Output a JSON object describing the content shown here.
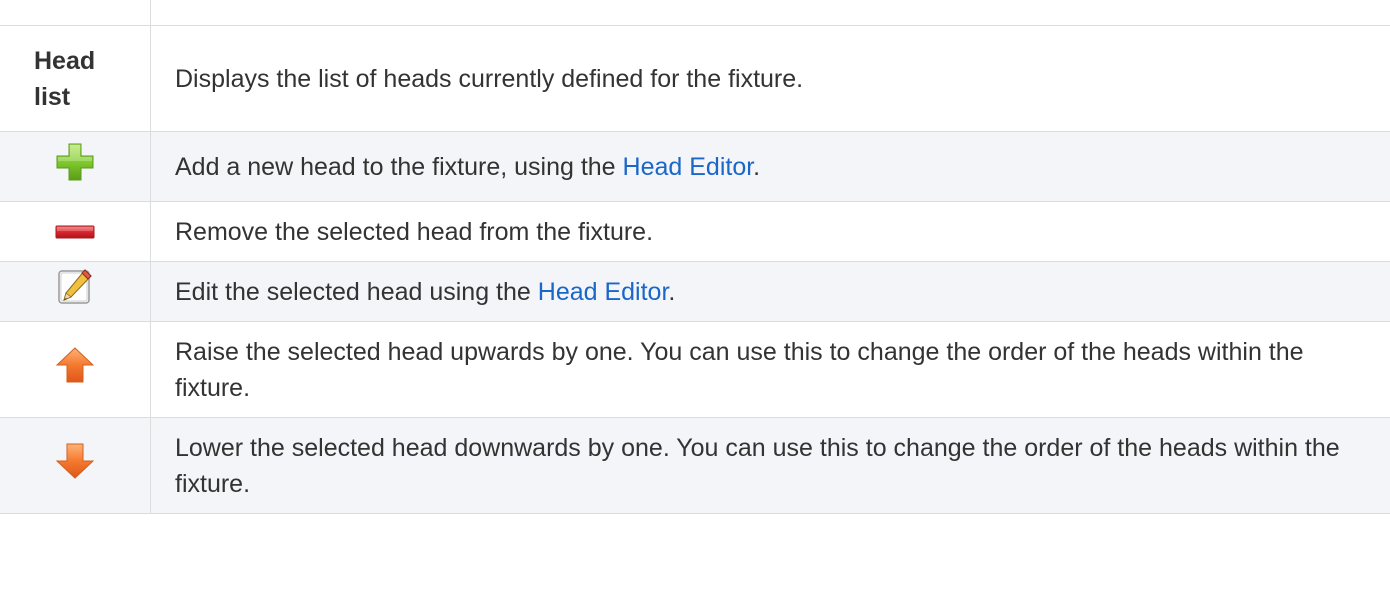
{
  "rows": [
    {
      "term": "Head list",
      "term_line1": "Head",
      "term_line2": "list",
      "description": "Displays the list of heads currently defined for the fixture."
    },
    {
      "icon": "add-plus-icon",
      "text_before": "Add a new head to the fixture, using the ",
      "link": "Head Editor",
      "text_after": "."
    },
    {
      "icon": "remove-minus-icon",
      "description": "Remove the selected head from the fixture."
    },
    {
      "icon": "edit-pencil-icon",
      "text_before": "Edit the selected head using the ",
      "link": "Head Editor",
      "text_after": "."
    },
    {
      "icon": "raise-up-arrow-icon",
      "description": "Raise the selected head upwards by one. You can use this to change the order of the heads within the fixture."
    },
    {
      "icon": "lower-down-arrow-icon",
      "description": "Lower the selected head downwards by one. You can use this to change the order of the heads within the fixture."
    }
  ],
  "colors": {
    "link": "#1a66c9",
    "border": "#dcdcdc",
    "row_shade": "#f3f5f8",
    "text": "#333333"
  }
}
